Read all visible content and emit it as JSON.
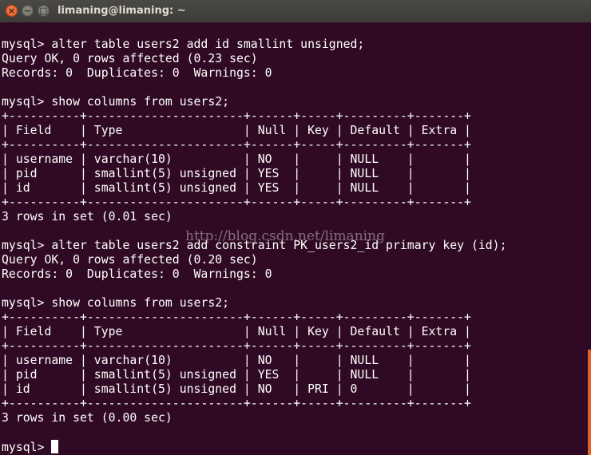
{
  "window": {
    "title": "limaning@limaning: ~",
    "close_glyph": "×",
    "minimize_glyph": "−",
    "maximize_glyph": "□"
  },
  "terminal": {
    "lines": [
      "mysql> alter table users2 add id smallint unsigned;",
      "Query OK, 0 rows affected (0.23 sec)",
      "Records: 0  Duplicates: 0  Warnings: 0",
      "",
      "mysql> show columns from users2;",
      "+----------+----------------------+------+-----+---------+-------+",
      "| Field    | Type                 | Null | Key | Default | Extra |",
      "+----------+----------------------+------+-----+---------+-------+",
      "| username | varchar(10)          | NO   |     | NULL    |       |",
      "| pid      | smallint(5) unsigned | YES  |     | NULL    |       |",
      "| id       | smallint(5) unsigned | YES  |     | NULL    |       |",
      "+----------+----------------------+------+-----+---------+-------+",
      "3 rows in set (0.01 sec)",
      "",
      "mysql> alter table users2 add constraint PK_users2_id primary key (id);",
      "Query OK, 0 rows affected (0.20 sec)",
      "Records: 0  Duplicates: 0  Warnings: 0",
      "",
      "mysql> show columns from users2;",
      "+----------+----------------------+------+-----+---------+-------+",
      "| Field    | Type                 | Null | Key | Default | Extra |",
      "+----------+----------------------+------+-----+---------+-------+",
      "| username | varchar(10)          | NO   |     | NULL    |       |",
      "| pid      | smallint(5) unsigned | YES  |     | NULL    |       |",
      "| id       | smallint(5) unsigned | NO   | PRI | 0       |       |",
      "+----------+----------------------+------+-----+---------+-------+",
      "3 rows in set (0.00 sec)",
      ""
    ],
    "prompt": "mysql> ",
    "watermark": "http://blog.csdn.net/limaning"
  },
  "colors": {
    "background": "#300a24",
    "text": "#ffffff",
    "titlebar": "#3c3b37",
    "close_button": "#e25920",
    "scrollbar": "#e0632a"
  }
}
